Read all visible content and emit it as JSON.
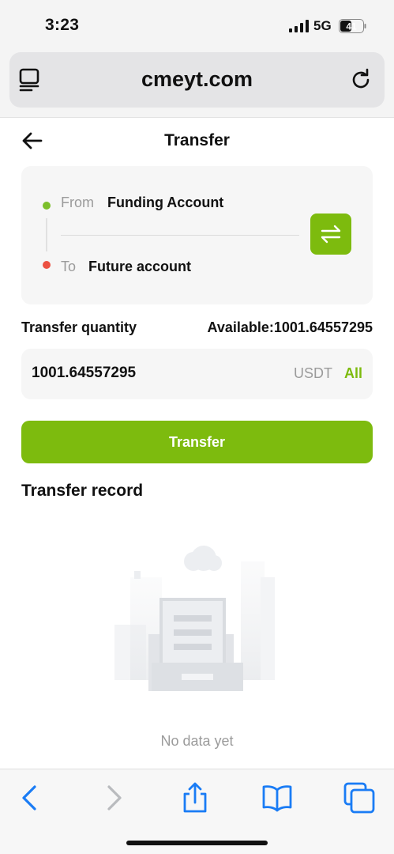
{
  "status_bar": {
    "time": "3:23",
    "network": "5G",
    "battery": "41"
  },
  "browser": {
    "url": "cmeyt.com"
  },
  "header": {
    "title": "Transfer"
  },
  "accounts": {
    "from_label": "From",
    "from_value": "Funding Account",
    "to_label": "To",
    "to_value": "Future account"
  },
  "quantity": {
    "label": "Transfer quantity",
    "available": "Available:1001.64557295",
    "value": "1001.64557295",
    "unit": "USDT",
    "all_label": "All"
  },
  "actions": {
    "transfer_label": "Transfer"
  },
  "records": {
    "title": "Transfer record",
    "empty_text": "No data yet"
  },
  "colors": {
    "accent": "#7dbb0e",
    "from_dot": "#7cbf2a",
    "to_dot": "#ec5142",
    "toolbar_blue": "#1a7cf5"
  },
  "icons": {
    "reader": "reader-icon",
    "reload": "reload-icon",
    "back": "back-arrow-icon",
    "swap": "swap-icon",
    "toolbar": [
      "back-icon",
      "forward-icon",
      "share-icon",
      "bookmarks-icon",
      "tabs-icon"
    ]
  }
}
